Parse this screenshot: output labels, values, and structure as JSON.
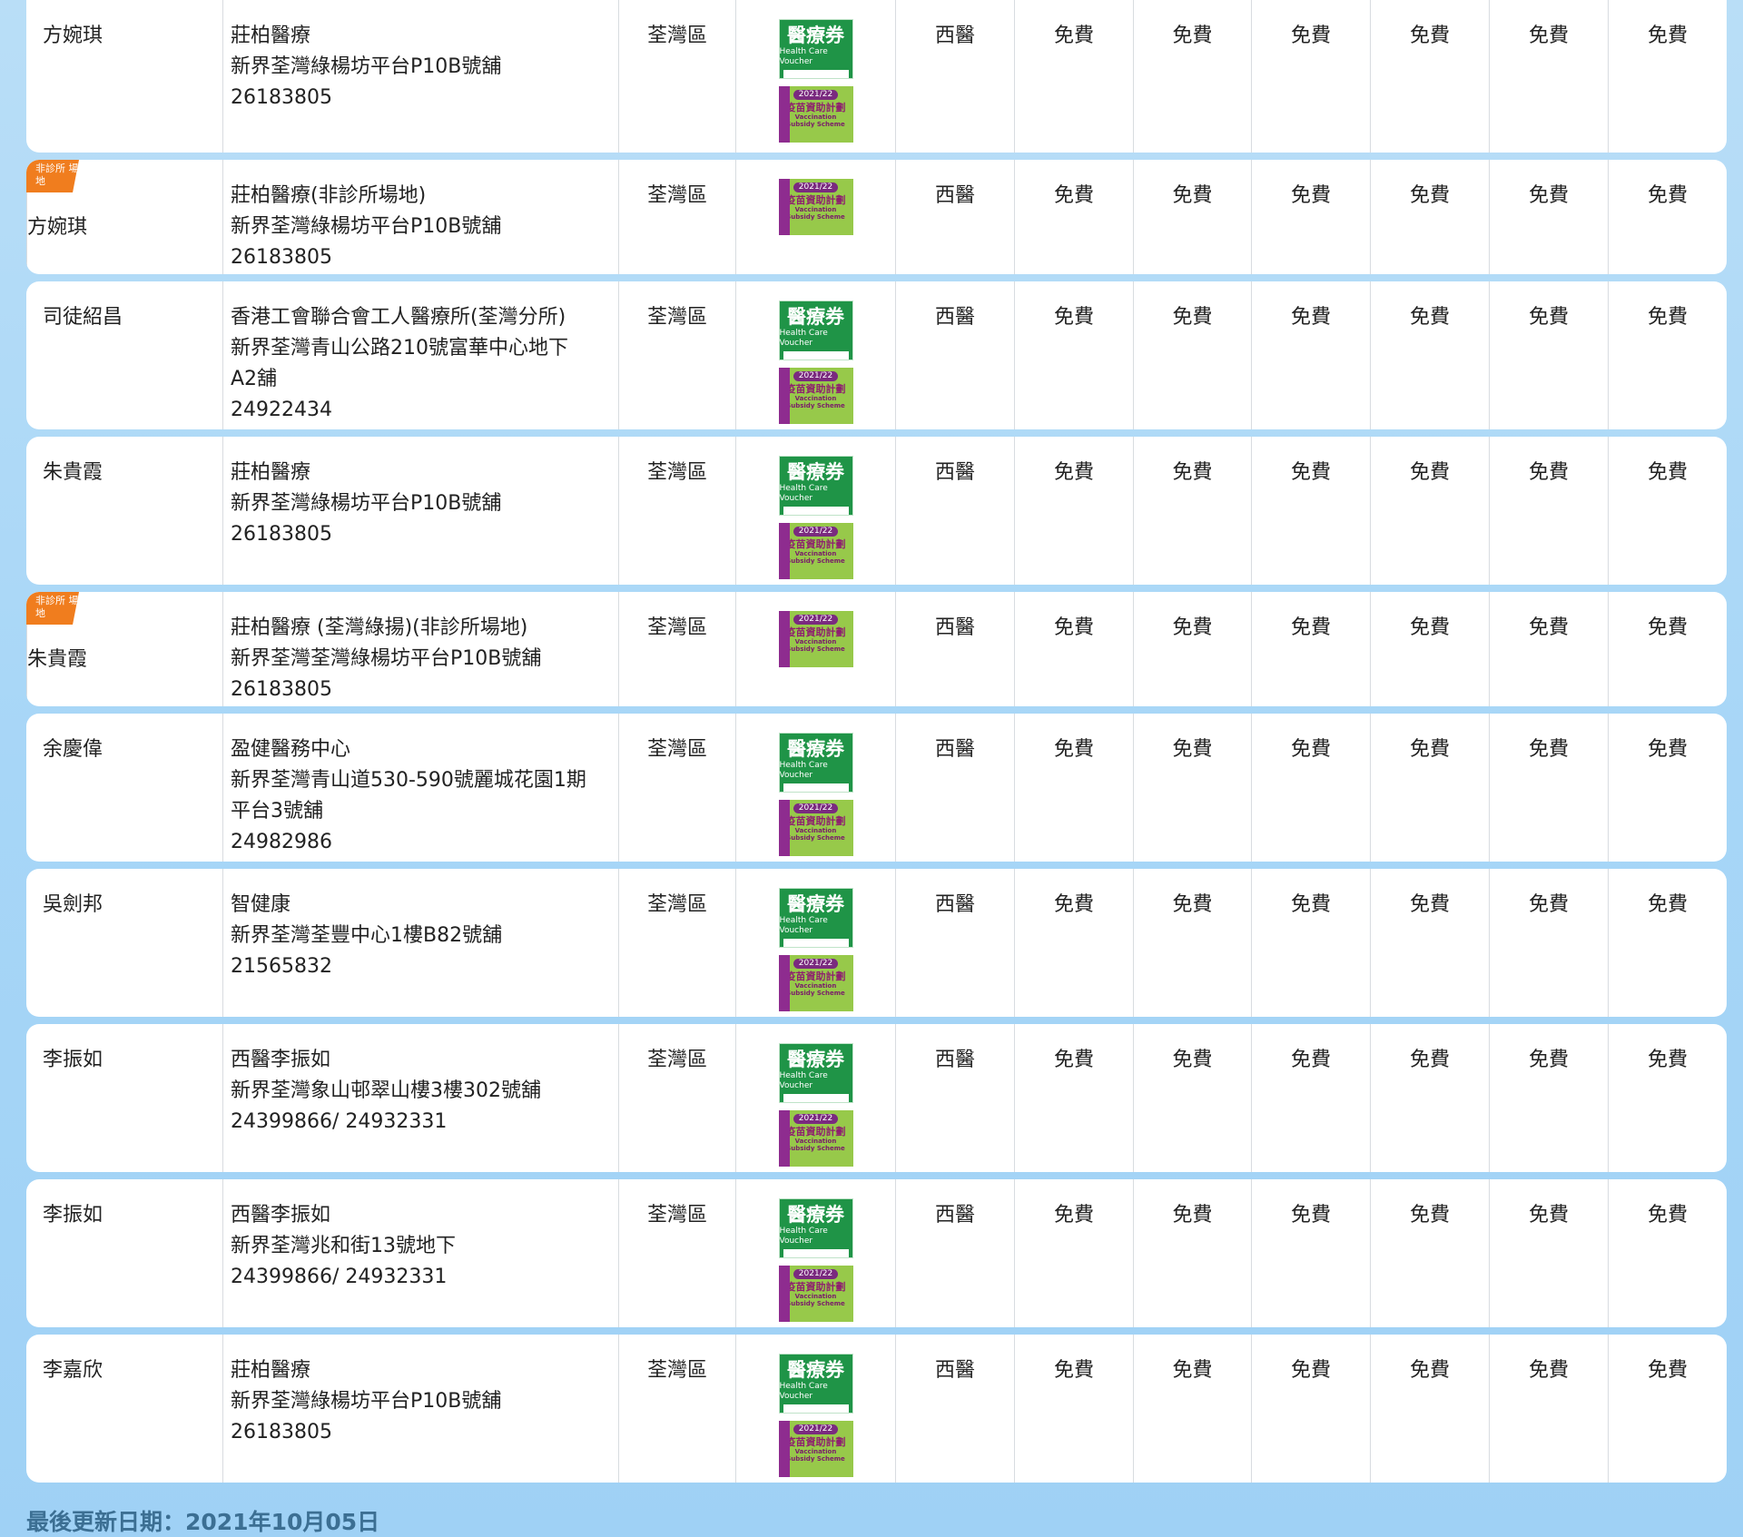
{
  "badge_text": "非診所 場地",
  "logos": {
    "hcv_title": "醫療券",
    "hcv_sub": "Health Care Voucher",
    "vss_year": "2021/22",
    "vss_title": "疫苗資助計劃",
    "vss_sub1": "Vaccination",
    "vss_sub2": "Subsidy Scheme"
  },
  "rows": [
    {
      "doctor": "方婉琪",
      "clinic": [
        "莊柏醫療",
        "新界荃灣綠楊坊平台P10B號舖",
        "26183805"
      ],
      "district": "荃灣區",
      "type": "西醫",
      "fees": [
        "免費",
        "免費",
        "免費",
        "免費",
        "免費",
        "免費"
      ],
      "hcv": true,
      "badge": false
    },
    {
      "doctor": "方婉琪",
      "clinic": [
        "莊柏醫療(非診所場地)",
        "新界荃灣綠楊坊平台P10B號舖",
        "26183805"
      ],
      "district": "荃灣區",
      "type": "西醫",
      "fees": [
        "免費",
        "免費",
        "免費",
        "免費",
        "免費",
        "免費"
      ],
      "hcv": false,
      "badge": true
    },
    {
      "doctor": "司徒紹昌",
      "clinic": [
        "香港工會聯合會工人醫療所(荃灣分所)",
        "新界荃灣青山公路210號富華中心地下",
        "A2舖",
        "24922434"
      ],
      "district": "荃灣區",
      "type": "西醫",
      "fees": [
        "免費",
        "免費",
        "免費",
        "免費",
        "免費",
        "免費"
      ],
      "hcv": true,
      "badge": false
    },
    {
      "doctor": "朱貴霞",
      "clinic": [
        "莊柏醫療",
        "新界荃灣綠楊坊平台P10B號舖",
        "26183805"
      ],
      "district": "荃灣區",
      "type": "西醫",
      "fees": [
        "免費",
        "免費",
        "免費",
        "免費",
        "免費",
        "免費"
      ],
      "hcv": true,
      "badge": false
    },
    {
      "doctor": "朱貴霞",
      "clinic": [
        "莊柏醫療 (荃灣綠揚)(非診所場地)",
        "新界荃灣荃灣綠楊坊平台P10B號舖",
        "26183805"
      ],
      "district": "荃灣區",
      "type": "西醫",
      "fees": [
        "免費",
        "免費",
        "免費",
        "免費",
        "免費",
        "免費"
      ],
      "hcv": false,
      "badge": true
    },
    {
      "doctor": "余慶偉",
      "clinic": [
        "盈健醫務中心",
        "新界荃灣青山道530-590號麗城花園1期",
        "平台3號舖",
        "24982986"
      ],
      "district": "荃灣區",
      "type": "西醫",
      "fees": [
        "免費",
        "免費",
        "免費",
        "免費",
        "免費",
        "免費"
      ],
      "hcv": true,
      "badge": false
    },
    {
      "doctor": "吳劍邦",
      "clinic": [
        "智健康",
        "新界荃灣荃豐中心1樓B82號舖",
        "21565832"
      ],
      "district": "荃灣區",
      "type": "西醫",
      "fees": [
        "免費",
        "免費",
        "免費",
        "免費",
        "免費",
        "免費"
      ],
      "hcv": true,
      "badge": false
    },
    {
      "doctor": "李振如",
      "clinic": [
        "西醫李振如",
        "新界荃灣象山邨翠山樓3樓302號舖",
        "24399866/ 24932331"
      ],
      "district": "荃灣區",
      "type": "西醫",
      "fees": [
        "免費",
        "免費",
        "免費",
        "免費",
        "免費",
        "免費"
      ],
      "hcv": true,
      "badge": false
    },
    {
      "doctor": "李振如",
      "clinic": [
        "西醫李振如",
        "新界荃灣兆和街13號地下",
        "24399866/ 24932331"
      ],
      "district": "荃灣區",
      "type": "西醫",
      "fees": [
        "免費",
        "免費",
        "免費",
        "免費",
        "免費",
        "免費"
      ],
      "hcv": true,
      "badge": false
    },
    {
      "doctor": "李嘉欣",
      "clinic": [
        "莊柏醫療",
        "新界荃灣綠楊坊平台P10B號舖",
        "26183805"
      ],
      "district": "荃灣區",
      "type": "西醫",
      "fees": [
        "免費",
        "免費",
        "免費",
        "免費",
        "免費",
        "免費"
      ],
      "hcv": true,
      "badge": false
    }
  ],
  "footer": "最後更新日期：2021年10月05日"
}
